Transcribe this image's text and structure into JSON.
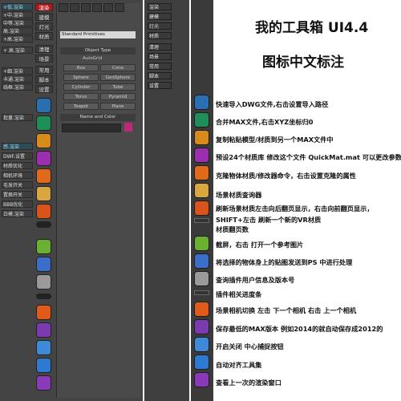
{
  "left_stripA": [
    "+低.渲染",
    "+中.渲染",
    "中等.渲染",
    "高.渲染",
    "+高.渲染",
    "+ 高.渲染",
    "+细.渲染",
    "卡通.渲染",
    "线框.渲染",
    "",
    "批量.渲染",
    "",
    "",
    "",
    "感.渲染",
    "DWF.设置",
    "材质优化",
    "相机环境",
    "毛发开关",
    "置换开关",
    "BBB优化",
    "白模.渲染"
  ],
  "left_stripB": [
    "渲染",
    "建模",
    "灯光",
    "材质",
    "清理",
    "场景",
    "常用",
    "脚本",
    "设置"
  ],
  "cmd_panel": {
    "dropdown": "Standard Primitives",
    "object_type_header": "Object Type",
    "autogrid": "AutoGrid",
    "buttons": [
      "Box",
      "Cone",
      "Sphere",
      "GeoSphere",
      "Cylinder",
      "Tube",
      "Torus",
      "Pyramid",
      "Teapot",
      "Plane"
    ],
    "name_color_header": "Name and Color"
  },
  "right_panel_buttons": [
    "渲染",
    "建模",
    "灯光",
    "材质",
    "清理",
    "场景",
    "常用",
    "脚本",
    "设置"
  ],
  "titles": {
    "line1": "我的工具箱 UI4.4",
    "line2": "图标中文标注"
  },
  "descriptions": [
    "快速导入DWG文件,右击设置导入路径",
    "合并MAX文件,右击XYZ坐标归0",
    "复制粘贴模型/材质到另一个MAX文件中",
    "预设24个材质库  修改这个文件 QuickMat.mat 可以更改参数",
    "克隆物体材质/修改器命令，右击设置克隆的属性",
    "场景材质查询器",
    "刷新场景材质左击向后翻页显示，右击向前翻页显示，",
    "SHIFT+左击  刷新一个新的VR材质",
    "材质翻页数",
    "截屏，右击  打开一个参考图片",
    "将选择的物体身上的贴图发送到PS 中进行处理",
    "查询插件用户信息及版本号",
    "插件相关进度条",
    "场景相机切换  左击  下一个相机  右击  上一个相机",
    "保存最低的MAX版本  例如2014的就自动保存成2012的",
    "开启关闭  中心捕捉按钮",
    "自动对齐工具集",
    "查看上一次的渲染窗口"
  ],
  "icons": [
    "dwg-import-icon",
    "merge-max-icon",
    "copy-paste-icon",
    "material-library-icon",
    "clone-icon",
    "material-browser-icon",
    "refresh-material-icon",
    "",
    "screenshot-icon",
    "send-to-ps-icon",
    "plugin-info-icon",
    "",
    "camera-switch-icon",
    "save-version-icon",
    "center-snap-icon",
    "align-icon",
    "render-window-icon"
  ],
  "colors": {
    "accent_red": "#b9141a",
    "panel_dark": "#444444"
  }
}
